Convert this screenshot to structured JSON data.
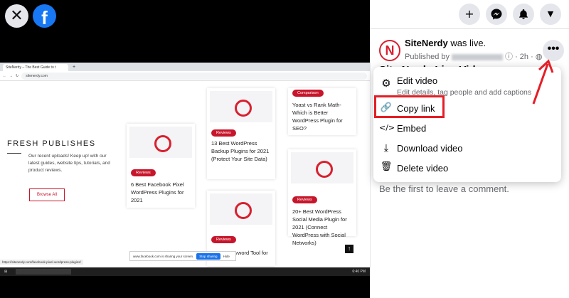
{
  "video": {
    "close_icon": "x-icon",
    "logo_letter": "f",
    "browser": {
      "tab_title": "SiteNerdy – The Best Guide to t",
      "url": "sitenerdy.com",
      "section_title": "FRESH PUBLISHES",
      "section_desc": "Our recent uploads! Keep up! with our latest guides, website tips, tutorials, and product reviews.",
      "browse_all": "Browse All",
      "cards": [
        {
          "badge": "Reviews",
          "title": "6 Best Facebook Pixel WordPress Plugins for 2021"
        },
        {
          "badge": "Reviews",
          "title": "13 Best WordPress Backup Plugins for 2021 (Protect Your Site Data)"
        },
        {
          "badge": "Comparison",
          "title": "Yoast vs Rank Math- Which is Better WordPress Plugin for SEO?"
        },
        {
          "badge": "Reviews",
          "title": "20+ Best WordPress Social Media Plugin for 2021 (Connect WordPress with Social Networks)"
        },
        {
          "badge": "Reviews",
          "title": "Keyword Tool for"
        }
      ],
      "share_text": "www.facebook.com is sharing your screen.",
      "stop_sharing": "Stop sharing",
      "hide": "Hide",
      "status_url": "https://sitenerdy.com/facebook-pixel-wordpress-plugins/",
      "time": "6:40 PM"
    }
  },
  "header_buttons": [
    {
      "name": "create-icon",
      "glyph": "+"
    },
    {
      "name": "messenger-icon",
      "glyph": "⚡"
    },
    {
      "name": "notifications-icon",
      "glyph": "🔔"
    },
    {
      "name": "account-menu-icon",
      "glyph": "▼"
    }
  ],
  "post": {
    "avatar_letter": "N",
    "page_name": "SiteNerdy",
    "status": " was live.",
    "published_by": "Published by",
    "time": "· 2h ·",
    "title": "Site Nerdy Live Video"
  },
  "menu": [
    {
      "label": "Edit video",
      "sub": "Edit details, tag people and add captions",
      "icon": "gear-icon",
      "glyph": "⚙"
    },
    {
      "label": "Copy link",
      "sub": "",
      "icon": "link-icon",
      "glyph": "🔗"
    },
    {
      "label": "Embed",
      "sub": "",
      "icon": "code-icon",
      "glyph": "</>"
    },
    {
      "label": "Download video",
      "sub": "",
      "icon": "download-icon",
      "glyph": "⤓"
    },
    {
      "label": "Delete video",
      "sub": "",
      "icon": "trash-icon",
      "glyph": "🗑"
    }
  ],
  "comment_prompt": "Be the first to leave a comment.",
  "colors": {
    "fb_blue": "#1877f2",
    "highlight_red": "#e41e26",
    "brand_red": "#c7162b"
  }
}
